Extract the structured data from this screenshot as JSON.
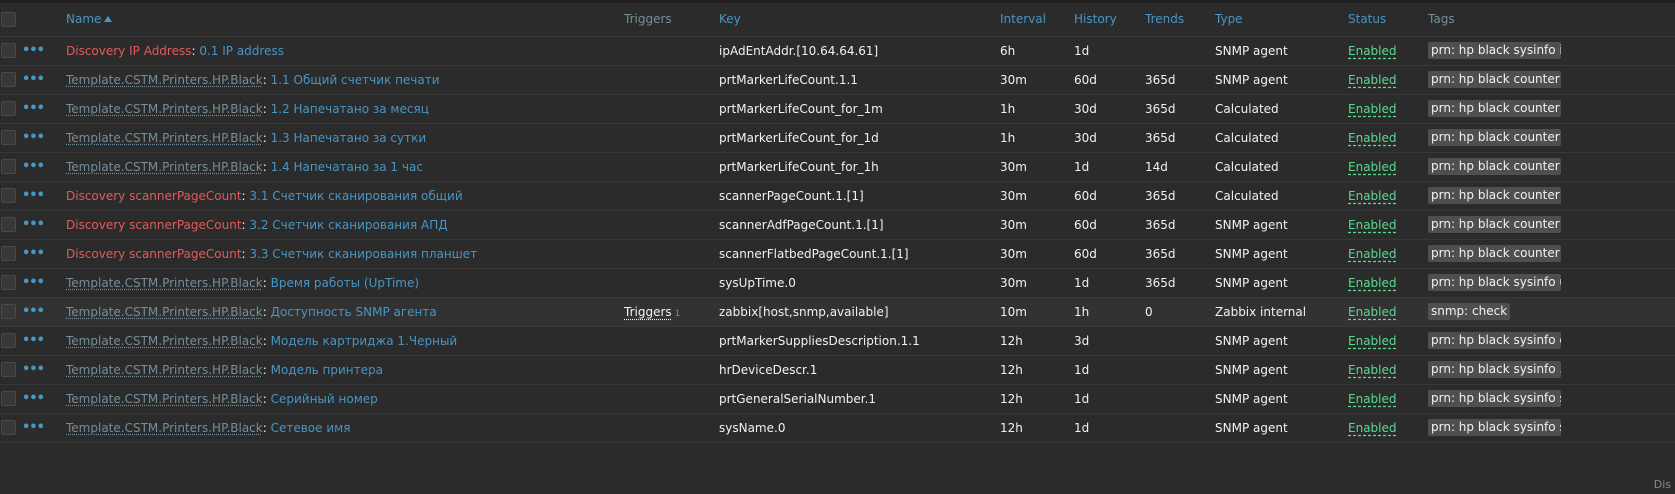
{
  "header": {
    "name": "Name",
    "triggers": "Triggers",
    "key": "Key",
    "interval": "Interval",
    "history": "History",
    "trends": "Trends",
    "type": "Type",
    "status": "Status",
    "tags": "Tags"
  },
  "rows": [
    {
      "prefix": "Discovery IP Address",
      "prefix_kind": "discovery",
      "name": "0.1 IP address",
      "triggers": "",
      "triggers_count": "",
      "key": "ipAdEntAddr.[10.64.64.61]",
      "interval": "6h",
      "history": "1d",
      "trends": "",
      "type": "SNMP agent",
      "status": "Enabled",
      "tag": "prn: hp black sysinfo ip"
    },
    {
      "prefix": "Template.CSTM.Printers.HP.Black",
      "prefix_kind": "template",
      "name": "1.1 Общий счетчик печати",
      "triggers": "",
      "triggers_count": "",
      "key": "prtMarkerLifeCount.1.1",
      "interval": "30m",
      "history": "60d",
      "trends": "365d",
      "type": "SNMP agent",
      "status": "Enabled",
      "tag": "prn: hp black counter"
    },
    {
      "prefix": "Template.CSTM.Printers.HP.Black",
      "prefix_kind": "template",
      "name": "1.2 Напечатано за месяц",
      "triggers": "",
      "triggers_count": "",
      "key": "prtMarkerLifeCount_for_1m",
      "interval": "1h",
      "history": "30d",
      "trends": "365d",
      "type": "Calculated",
      "status": "Enabled",
      "tag": "prn: hp black counter"
    },
    {
      "prefix": "Template.CSTM.Printers.HP.Black",
      "prefix_kind": "template",
      "name": "1.3 Напечатано за сутки",
      "triggers": "",
      "triggers_count": "",
      "key": "prtMarkerLifeCount_for_1d",
      "interval": "1h",
      "history": "30d",
      "trends": "365d",
      "type": "Calculated",
      "status": "Enabled",
      "tag": "prn: hp black counter"
    },
    {
      "prefix": "Template.CSTM.Printers.HP.Black",
      "prefix_kind": "template",
      "name": "1.4 Напечатано за 1 час",
      "triggers": "",
      "triggers_count": "",
      "key": "prtMarkerLifeCount_for_1h",
      "interval": "30m",
      "history": "1d",
      "trends": "14d",
      "type": "Calculated",
      "status": "Enabled",
      "tag": "prn: hp black counter"
    },
    {
      "prefix": "Discovery scannerPageCount",
      "prefix_kind": "discovery",
      "name": "3.1 Счетчик сканирования общий",
      "triggers": "",
      "triggers_count": "",
      "key": "scannerPageCount.1.[1]",
      "interval": "30m",
      "history": "60d",
      "trends": "365d",
      "type": "Calculated",
      "status": "Enabled",
      "tag": "prn: hp black counter ..."
    },
    {
      "prefix": "Discovery scannerPageCount",
      "prefix_kind": "discovery",
      "name": "3.2 Счетчик сканирования АПД",
      "triggers": "",
      "triggers_count": "",
      "key": "scannerAdfPageCount.1.[1]",
      "interval": "30m",
      "history": "60d",
      "trends": "365d",
      "type": "SNMP agent",
      "status": "Enabled",
      "tag": "prn: hp black counter ..."
    },
    {
      "prefix": "Discovery scannerPageCount",
      "prefix_kind": "discovery",
      "name": "3.3 Счетчик сканирования планшет",
      "triggers": "",
      "triggers_count": "",
      "key": "scannerFlatbedPageCount.1.[1]",
      "interval": "30m",
      "history": "60d",
      "trends": "365d",
      "type": "SNMP agent",
      "status": "Enabled",
      "tag": "prn: hp black counter ..."
    },
    {
      "prefix": "Template.CSTM.Printers.HP.Black",
      "prefix_kind": "template",
      "name": "Время работы (UpTime)",
      "triggers": "",
      "triggers_count": "",
      "key": "sysUpTime.0",
      "interval": "30m",
      "history": "1d",
      "trends": "365d",
      "type": "SNMP agent",
      "status": "Enabled",
      "tag": "prn: hp black sysinfo u..."
    },
    {
      "prefix": "Template.CSTM.Printers.HP.Black",
      "prefix_kind": "template",
      "name": "Доступность SNMP агента",
      "triggers": "Triggers",
      "triggers_count": "1",
      "key": "zabbix[host,snmp,available]",
      "interval": "10m",
      "history": "1h",
      "trends": "0",
      "type": "Zabbix internal",
      "status": "Enabled",
      "tag": "snmp: check"
    },
    {
      "prefix": "Template.CSTM.Printers.HP.Black",
      "prefix_kind": "template",
      "name": "Модель картриджа 1.Черный",
      "triggers": "",
      "triggers_count": "",
      "key": "prtMarkerSuppliesDescription.1.1",
      "interval": "12h",
      "history": "3d",
      "trends": "",
      "type": "SNMP agent",
      "status": "Enabled",
      "tag": "prn: hp black sysinfo c..."
    },
    {
      "prefix": "Template.CSTM.Printers.HP.Black",
      "prefix_kind": "template",
      "name": "Модель принтера",
      "triggers": "",
      "triggers_count": "",
      "key": "hrDeviceDescr.1",
      "interval": "12h",
      "history": "1d",
      "trends": "",
      "type": "SNMP agent",
      "status": "Enabled",
      "tag": "prn: hp black sysinfo ..."
    },
    {
      "prefix": "Template.CSTM.Printers.HP.Black",
      "prefix_kind": "template",
      "name": "Серийный номер",
      "triggers": "",
      "triggers_count": "",
      "key": "prtGeneralSerialNumber.1",
      "interval": "12h",
      "history": "1d",
      "trends": "",
      "type": "SNMP agent",
      "status": "Enabled",
      "tag": "prn: hp black sysinfo sn"
    },
    {
      "prefix": "Template.CSTM.Printers.HP.Black",
      "prefix_kind": "template",
      "name": "Сетевое имя",
      "triggers": "",
      "triggers_count": "",
      "key": "sysName.0",
      "interval": "12h",
      "history": "1d",
      "trends": "",
      "type": "SNMP agent",
      "status": "Enabled",
      "tag": "prn: hp black sysinfo sn"
    }
  ],
  "footer": {
    "label": "Dis"
  },
  "colors": {
    "background": "#2b2b2b",
    "link": "#4796c4",
    "discovery": "#e45959",
    "template": "#768d99",
    "enabled": "#59db8f",
    "tag_bg": "#4f4f4f"
  }
}
